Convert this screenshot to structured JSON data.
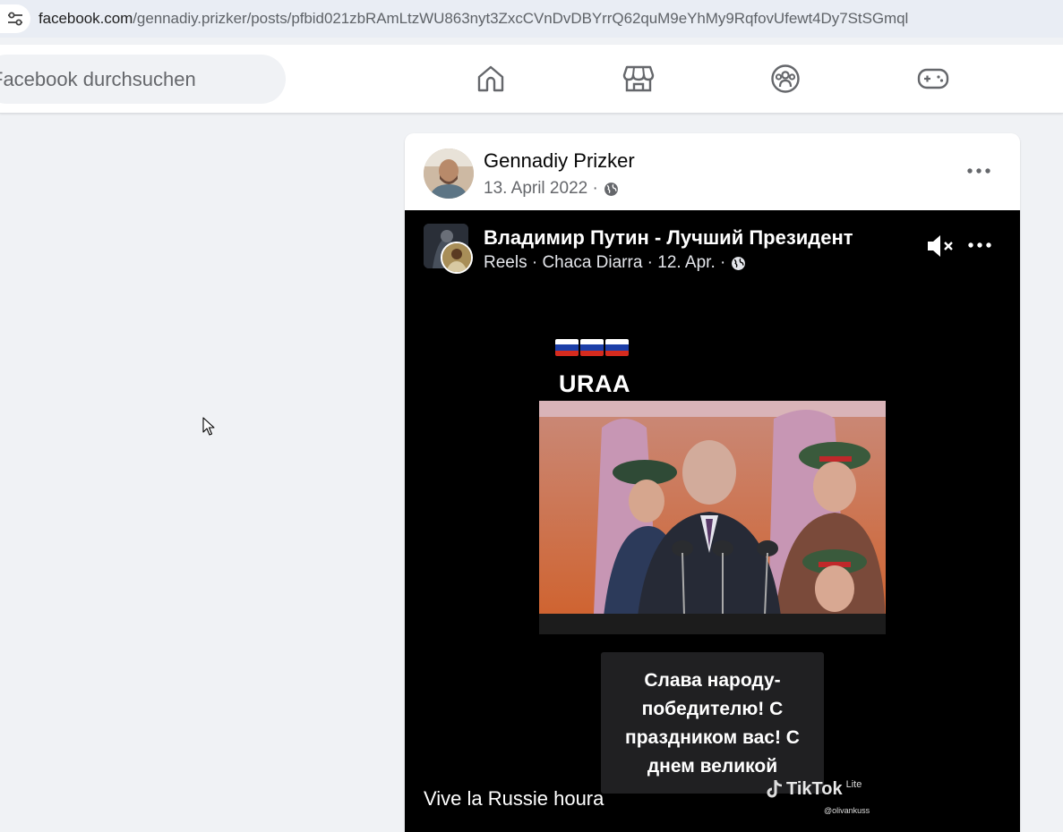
{
  "browser": {
    "url_host": "facebook.com",
    "url_path": "/gennadiy.prizker/posts/pfbid021zbRAmLtzWU863nyt3ZxcCVnDvDBYrrQ62quM9eYhMy9RqfovUfewt4Dy7StSGmql"
  },
  "nav": {
    "search_placeholder": "Facebook durchsuchen",
    "icons": [
      "home-icon",
      "marketplace-icon",
      "groups-icon",
      "gaming-icon"
    ]
  },
  "post": {
    "author": "Gennadiy Prizker",
    "date": "13. April 2022 ·",
    "audience_icon": "globe-icon"
  },
  "reel": {
    "title": "Владимир Путин - Лучший Президент",
    "meta": "Reels · Chaca Diarra · 12. Apr. ·",
    "overlay_title": "URAA",
    "caption_lines": [
      "Слава народу-",
      "победителю! С",
      "праздником вас! С",
      "днем великой"
    ],
    "description": "Vive la Russie houra",
    "watermark": "TikTok",
    "watermark_suffix": "Lite",
    "watermark_user": "@olivankuss"
  },
  "colors": {
    "fb_background": "#f0f2f5",
    "reel_background": "#000000",
    "flag_white": "#ffffff",
    "flag_blue": "#1c3fa8",
    "flag_red": "#d52b1e"
  }
}
